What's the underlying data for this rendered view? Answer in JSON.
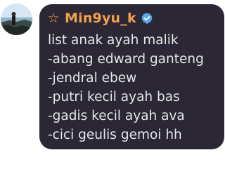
{
  "user": {
    "name": "Min9yu_k",
    "badge_icon": "star-icon",
    "verified_icon": "verified-badge-icon",
    "name_color": "#f5a24b",
    "verified_color": "#58a9e8"
  },
  "message": {
    "lines": [
      "list anak ayah malik",
      "-abang edward ganteng",
      "-jendral ebew",
      "-putri kecil ayah bas",
      "-gadis kecil ayah ava",
      "-cici geulis gemoi hh"
    ]
  },
  "colors": {
    "bubble_bg": "#2b2735",
    "text": "#e6e6e6"
  }
}
